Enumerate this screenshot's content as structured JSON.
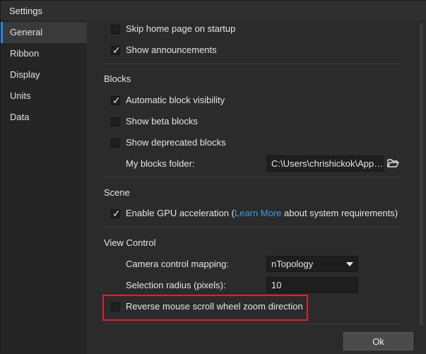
{
  "window": {
    "title": "Settings"
  },
  "sidebar": {
    "items": [
      {
        "label": "General",
        "active": true
      },
      {
        "label": "Ribbon"
      },
      {
        "label": "Display"
      },
      {
        "label": "Units"
      },
      {
        "label": "Data"
      }
    ]
  },
  "general": {
    "skip_home": {
      "label": "Skip home page on startup",
      "checked": false
    },
    "announcements": {
      "label": "Show announcements",
      "checked": true
    }
  },
  "blocks": {
    "section_title": "Blocks",
    "auto_visibility": {
      "label": "Automatic block visibility",
      "checked": true
    },
    "beta": {
      "label": "Show beta blocks",
      "checked": false
    },
    "deprecated": {
      "label": "Show deprecated blocks",
      "checked": false
    },
    "folder_label": "My blocks folder:",
    "folder_value": "C:\\Users\\chrishickok\\App…"
  },
  "scene": {
    "section_title": "Scene",
    "gpu": {
      "label_prefix": "Enable GPU acceleration (",
      "link_text": "Learn More",
      "label_suffix": " about system requirements)",
      "checked": true
    }
  },
  "view_control": {
    "section_title": "View Control",
    "camera_label": "Camera control mapping:",
    "camera_value": "nTopology",
    "radius_label": "Selection radius (pixels):",
    "radius_value": "10",
    "reverse_scroll": {
      "label": "Reverse mouse scroll wheel zoom direction",
      "checked": false
    }
  },
  "footer": {
    "ok_label": "Ok"
  },
  "colors": {
    "accent": "#2f86d6",
    "link": "#3d9be9",
    "highlight": "#e0222d"
  },
  "icons": {
    "folder": "folder-open-icon",
    "checkmark": "checkmark-icon",
    "dropdown": "chevron-down-icon"
  }
}
